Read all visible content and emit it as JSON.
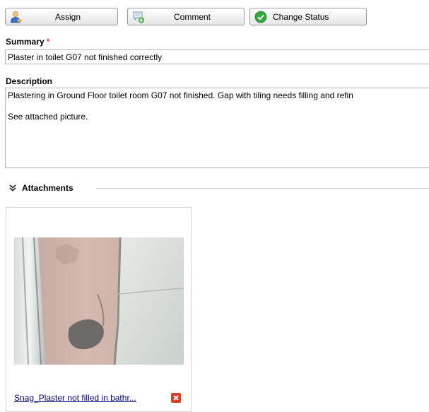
{
  "toolbar": {
    "assign_label": "Assign",
    "comment_label": "Comment",
    "change_status_label": "Change Status"
  },
  "form": {
    "summary_label": "Summary",
    "required_mark": "*",
    "summary_value": "Plaster in toilet G07 not finished correctly",
    "description_label": "Description",
    "description_value": "Plastering in Ground Floor toilet room G07 not finished. Gap with tiling needs filling and refin\n\nSee attached picture."
  },
  "attachments": {
    "title": "Attachments",
    "items": [
      {
        "filename": "Snag_Plaster not filled in bathr..."
      }
    ]
  },
  "colors": {
    "required": "#e04a3a",
    "link": "#00007a",
    "delete": "#d63d22",
    "status_icon": "#2eaa3a"
  }
}
